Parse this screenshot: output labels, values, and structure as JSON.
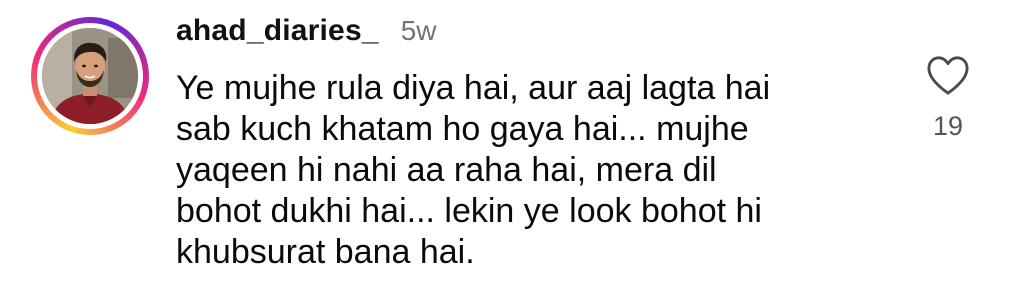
{
  "comment": {
    "username": "ahad_diaries_",
    "timestamp": "5w",
    "text": "Ye mujhe rula diya hai, aur aaj lagta hai\nsab kuch khatam ho gaya hai... mujhe\nyaqeen hi nahi aa raha hai, mera dil\nbohot dukhi hai... lekin ye look bohot hi\nkhubsurat bana hai.",
    "like_icon": "heart-outline-icon",
    "like_count": "19",
    "has_story_ring": true
  },
  "colors": {
    "story_ring_start": "#f9ce34",
    "story_ring_mid": "#ee2a7b",
    "story_ring_end": "#6228d7",
    "timestamp": "#737373",
    "like_count": "#555555"
  }
}
